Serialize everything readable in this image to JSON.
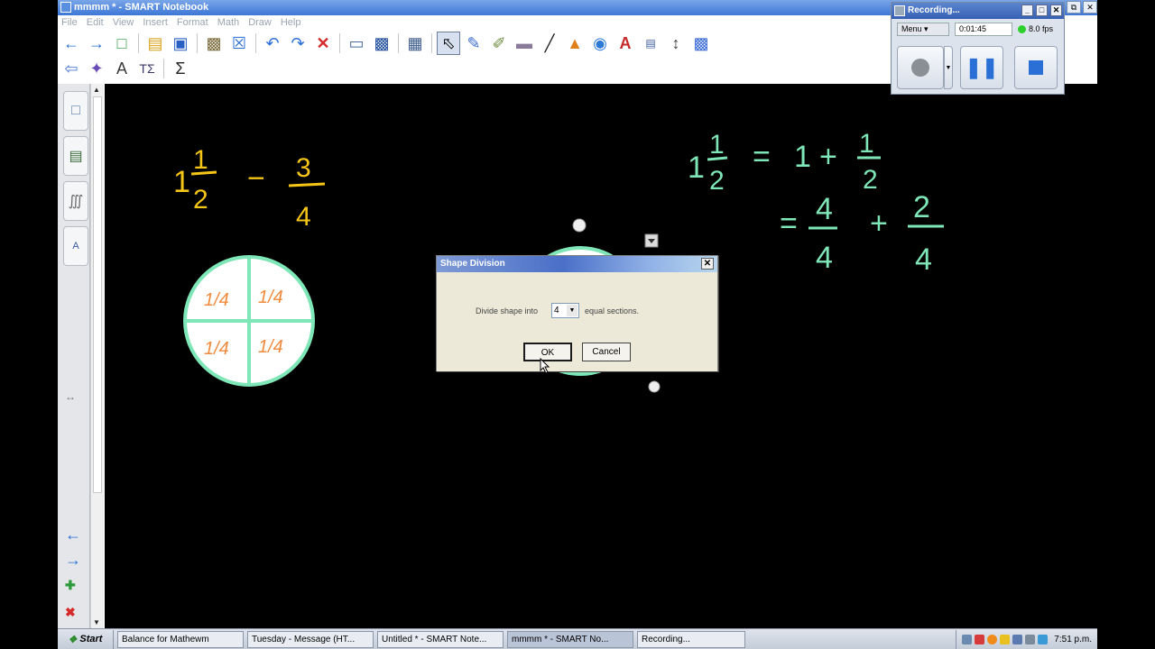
{
  "window": {
    "title": "mmmm * - SMART Notebook"
  },
  "menu": [
    "File",
    "Edit",
    "View",
    "Insert",
    "Format",
    "Math",
    "Draw",
    "Help"
  ],
  "toolbar1": [
    "back-icon",
    "forward-icon",
    "new-page-icon",
    "open-icon",
    "save-icon",
    "paste-icon",
    "delete-page-icon",
    "undo-icon",
    "redo-icon",
    "delete-icon",
    "full-screen-icon",
    "screen-shade-icon",
    "table-icon",
    "select-icon",
    "pen-icon",
    "creative-pen-icon",
    "eraser-icon",
    "line-icon",
    "shapes-icon",
    "fill-icon",
    "text-icon",
    "properties-icon",
    "move-toolbar-icon",
    "math-tools-icon"
  ],
  "toolbar2": [
    "previous-page-icon",
    "magic-pen-icon",
    "text-recognition-icon",
    "equation-icon",
    "sigma-icon"
  ],
  "canvas": {
    "left_expression": {
      "whole": "1",
      "num": "1",
      "den": "2",
      "op": "−",
      "num2": "3",
      "den2": "4"
    },
    "right_expression": {
      "whole": "1",
      "num": "1",
      "den": "2",
      "eq": "=",
      "plus": "+",
      "one": "1",
      "num_r": "1",
      "den_r": "2",
      "eq2": "=",
      "num_a": "4",
      "den_a": "4",
      "num_b": "2",
      "den_b": "4"
    },
    "circle_labels": [
      "1/4",
      "1/4",
      "1/4",
      "1/4"
    ]
  },
  "dialog": {
    "title": "Shape Division",
    "label_before": "Divide shape into",
    "sections_value": "4",
    "label_after": "equal sections.",
    "ok_label": "OK",
    "cancel_label": "Cancel"
  },
  "recorder": {
    "title": "Recording...",
    "menu_label": "Menu",
    "elapsed": "0:01:45",
    "fps": "8.0 fps"
  },
  "taskbar": {
    "start_label": "Start",
    "tasks": [
      "Balance for Mathewm",
      "Tuesday - Message (HT...",
      "Untitled * - SMART Note...",
      "mmmm * - SMART No...",
      "Recording..."
    ],
    "clock": "7:51 p.m."
  },
  "colors": {
    "yellow_ink": "#f5c518",
    "green_ink": "#7fe6b8",
    "orange_ink": "#f08a3c",
    "titlebar_blue": "#3c77d6"
  }
}
